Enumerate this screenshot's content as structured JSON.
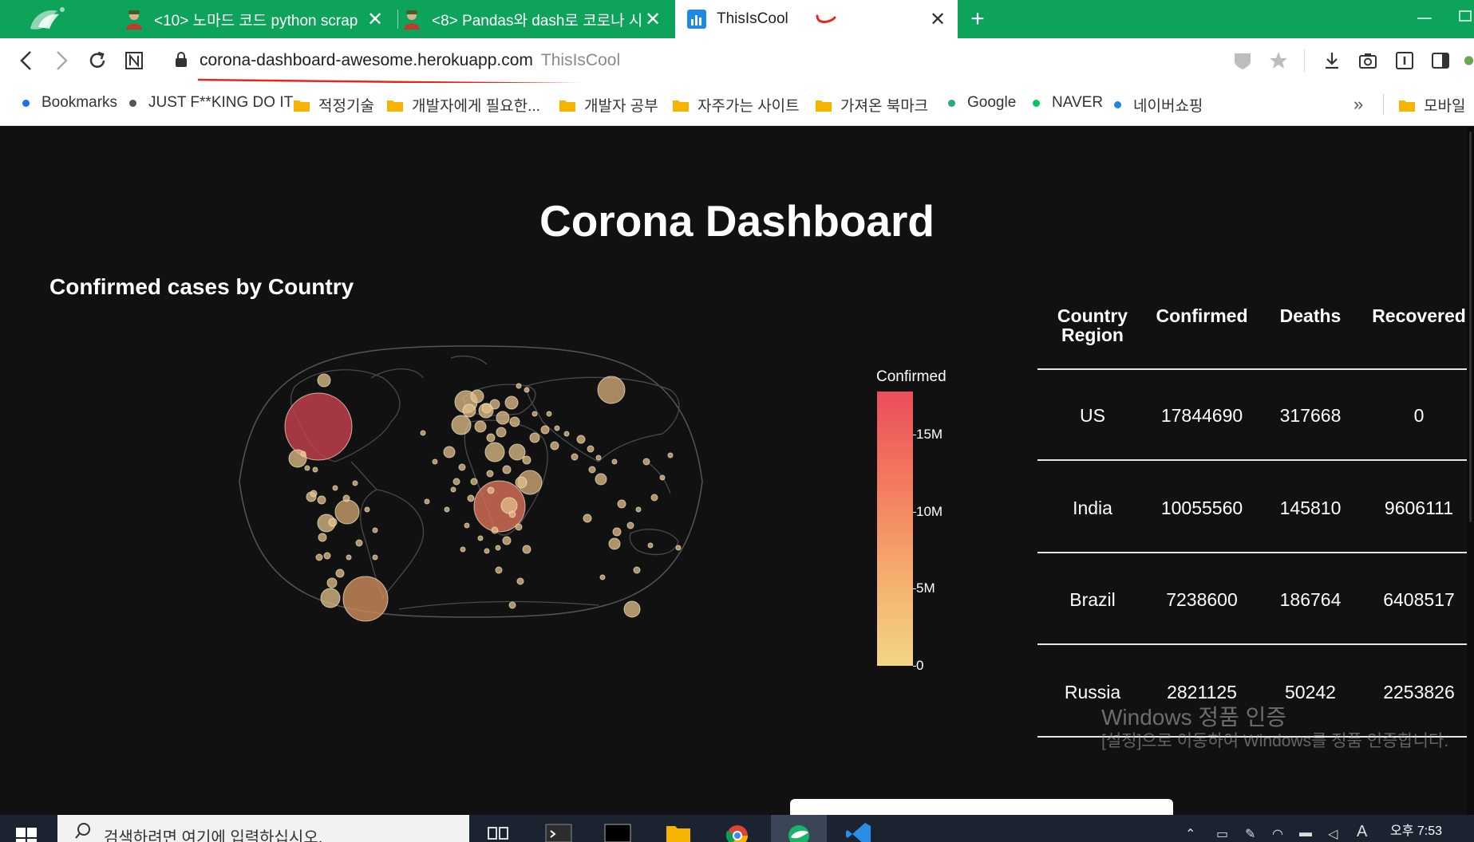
{
  "browser": {
    "tabs": [
      {
        "title": "<10> 노마드 코드 python scrap",
        "icon": "avatar-icon"
      },
      {
        "title": "<8> Pandas와 dash로 코로나 시",
        "icon": "avatar-icon"
      },
      {
        "title": "ThisIsCool",
        "icon": "chart-icon",
        "active": true
      }
    ],
    "new_tab_symbol": "+",
    "close_symbol": "✕",
    "address": {
      "url": "corona-dashboard-awesome.herokuapp.com",
      "page_title": "ThisIsCool"
    },
    "bookmarks": [
      {
        "label": "Bookmarks",
        "type": "dot",
        "color": "#1a73e8"
      },
      {
        "label": "JUST F**KING DO IT",
        "type": "dot",
        "color": "#555555"
      },
      {
        "label": "적정기술",
        "type": "folder"
      },
      {
        "label": "개발자에게 필요한...",
        "type": "folder"
      },
      {
        "label": "개발자 공부",
        "type": "folder"
      },
      {
        "label": "자주가는 사이트",
        "type": "folder"
      },
      {
        "label": "가져온 북마크",
        "type": "folder"
      },
      {
        "label": "Google",
        "type": "dot",
        "color": "#2aa876"
      },
      {
        "label": "NAVER",
        "type": "dot",
        "color": "#03c75a"
      },
      {
        "label": "네이버쇼핑",
        "type": "dot",
        "color": "#1e88e5"
      }
    ],
    "bookmarks_more": "»",
    "mobile_bookmark": "모바일"
  },
  "page": {
    "title": "Corona Dashboard",
    "map_title": "Confirmed cases by Country",
    "colorbar": {
      "title": "Confirmed",
      "ticks": [
        "15M",
        "10M",
        "5M",
        "0"
      ],
      "colors": [
        "#eb4d5c",
        "#f37d5f",
        "#f5aa6c",
        "#f3d687"
      ]
    },
    "table": {
      "headers": [
        "Country Region",
        "Confirmed",
        "Deaths",
        "Recovered"
      ],
      "rows": [
        [
          "US",
          "17844690",
          "317668",
          "0"
        ],
        [
          "India",
          "10055560",
          "145810",
          "9606111"
        ],
        [
          "Brazil",
          "7238600",
          "186764",
          "6408517"
        ],
        [
          "Russia",
          "2821125",
          "50242",
          "2253826"
        ]
      ]
    },
    "watermark": {
      "title": "Windows 정품 인증",
      "subtitle": "[설정]으로 이동하여 Windows를 정품 인증합니다."
    }
  },
  "taskbar": {
    "search_placeholder": "검색하려면 여기에 입력하십시오.",
    "time": "오후 7:53",
    "ime": "A"
  }
}
